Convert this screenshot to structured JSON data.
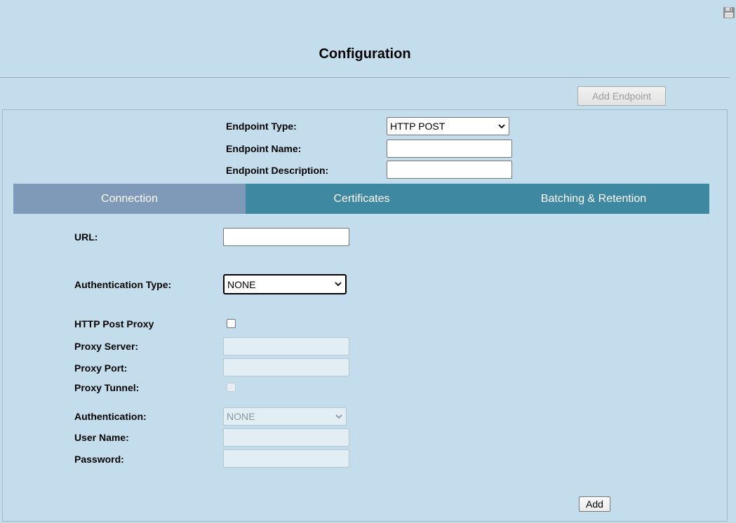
{
  "header": {
    "title": "Configuration",
    "save_icon": "floppy-disk-icon"
  },
  "toolbar": {
    "add_endpoint_label": "Add Endpoint"
  },
  "endpoint": {
    "type_label": "Endpoint Type:",
    "type_value": "HTTP POST",
    "name_label": "Endpoint Name:",
    "name_value": "",
    "description_label": "Endpoint Description:",
    "description_value": ""
  },
  "tabs": [
    {
      "label": "Connection",
      "active": true
    },
    {
      "label": "Certificates",
      "active": false
    },
    {
      "label": "Batching & Retention",
      "active": false
    }
  ],
  "connection": {
    "url_label": "URL:",
    "url_value": "",
    "auth_type_label": "Authentication Type:",
    "auth_type_value": "NONE",
    "proxy_label": "HTTP Post Proxy",
    "proxy_checked": false,
    "proxy_server_label": "Proxy Server:",
    "proxy_server_value": "",
    "proxy_port_label": "Proxy Port:",
    "proxy_port_value": "",
    "proxy_tunnel_label": "Proxy Tunnel:",
    "proxy_tunnel_checked": false,
    "authentication_label": "Authentication:",
    "authentication_value": "NONE",
    "username_label": "User Name:",
    "username_value": "",
    "password_label": "Password:",
    "password_value": ""
  },
  "footer": {
    "add_label": "Add"
  },
  "colors": {
    "background": "#c3ddec",
    "tab_inactive": "#3f88a1",
    "tab_active": "#7f99b8"
  }
}
